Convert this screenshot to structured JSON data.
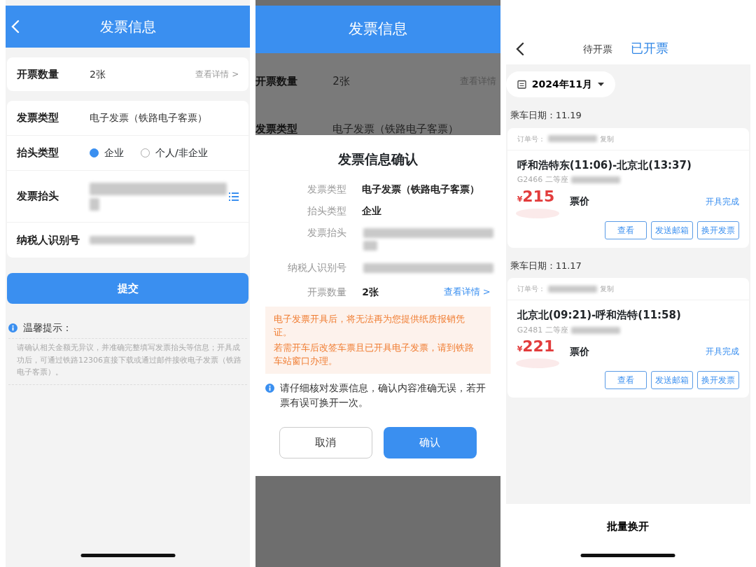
{
  "invoice_form": {
    "title": "发票信息",
    "quantity": {
      "label": "开票数量",
      "value": "2张",
      "link": "查看详情 >"
    },
    "fields": [
      {
        "kind": "text",
        "label": "发票类型",
        "value": "电子发票（铁路电子客票）"
      },
      {
        "kind": "radio",
        "label": "抬头类型",
        "options": [
          {
            "label": "企业",
            "selected": true
          },
          {
            "label": "个人/非企业",
            "selected": false
          }
        ]
      },
      {
        "kind": "redacted",
        "label": "发票抬头",
        "picker": true
      },
      {
        "kind": "redacted",
        "label": "纳税人识别号",
        "picker": false
      }
    ],
    "submit": "提交",
    "tip_title": "温馨提示：",
    "tip_text": "请确认相关金额无异议，并准确完整填写发票抬头等信息；开具成功后，可通过铁路12306直接下载或通过邮件接收电子发票（铁路电子客票）。"
  },
  "confirm_screen": {
    "title": "发票信息",
    "background_rows": [
      {
        "label": "开票数量",
        "value": "2张",
        "link": "查看详情"
      },
      {
        "label": "发票类型",
        "value": "电子发票（铁路电子客票）",
        "link": ""
      }
    ],
    "dialog": {
      "title": "发票信息确认",
      "rows": [
        {
          "kind": "text",
          "label": "发票类型",
          "value": "电子发票（铁路电子客票）"
        },
        {
          "kind": "text",
          "label": "抬头类型",
          "value": "企业"
        },
        {
          "kind": "redacted",
          "label": "发票抬头"
        },
        {
          "kind": "redacted",
          "label": "纳税人识别号"
        },
        {
          "kind": "link",
          "label": "开票数量",
          "value": "2张",
          "link": "查看详情 >"
        }
      ],
      "warnings": [
        "电子发票开具后，将无法再为您提供纸质报销凭证。",
        "若需开车后改签车票且已开具电子发票，请到铁路车站窗口办理。"
      ],
      "note": "请仔细核对发票信息，确认内容准确无误，若开票有误可换开一次。",
      "buttons": [
        {
          "label": "取消",
          "kind": "secondary"
        },
        {
          "label": "确认",
          "kind": "primary"
        }
      ]
    }
  },
  "issued_list": {
    "tabs": [
      {
        "label": "待开票",
        "selected": false
      },
      {
        "label": "已开票",
        "selected": true
      }
    ],
    "month": "2024年11月",
    "groups": [
      {
        "date": "乘车日期：11.19",
        "order_label": "订单号：",
        "copy": "复制",
        "route": "呼和浩特东(11:06)-北京北(13:37)",
        "train": "G2466 二等座",
        "currency": "¥",
        "price": "215",
        "price_label": "票价",
        "status": "开具完成",
        "actions": [
          "查看",
          "发送邮箱",
          "换开发票"
        ]
      },
      {
        "date": "乘车日期：11.17",
        "order_label": "订单号：",
        "copy": "复制",
        "route": "北京北(09:21)-呼和浩特(11:58)",
        "train": "G2481 二等座",
        "currency": "¥",
        "price": "221",
        "price_label": "票价",
        "status": "开具完成",
        "actions": [
          "查看",
          "发送邮箱",
          "换开发票"
        ]
      }
    ],
    "bottom_button": "批量换开"
  }
}
